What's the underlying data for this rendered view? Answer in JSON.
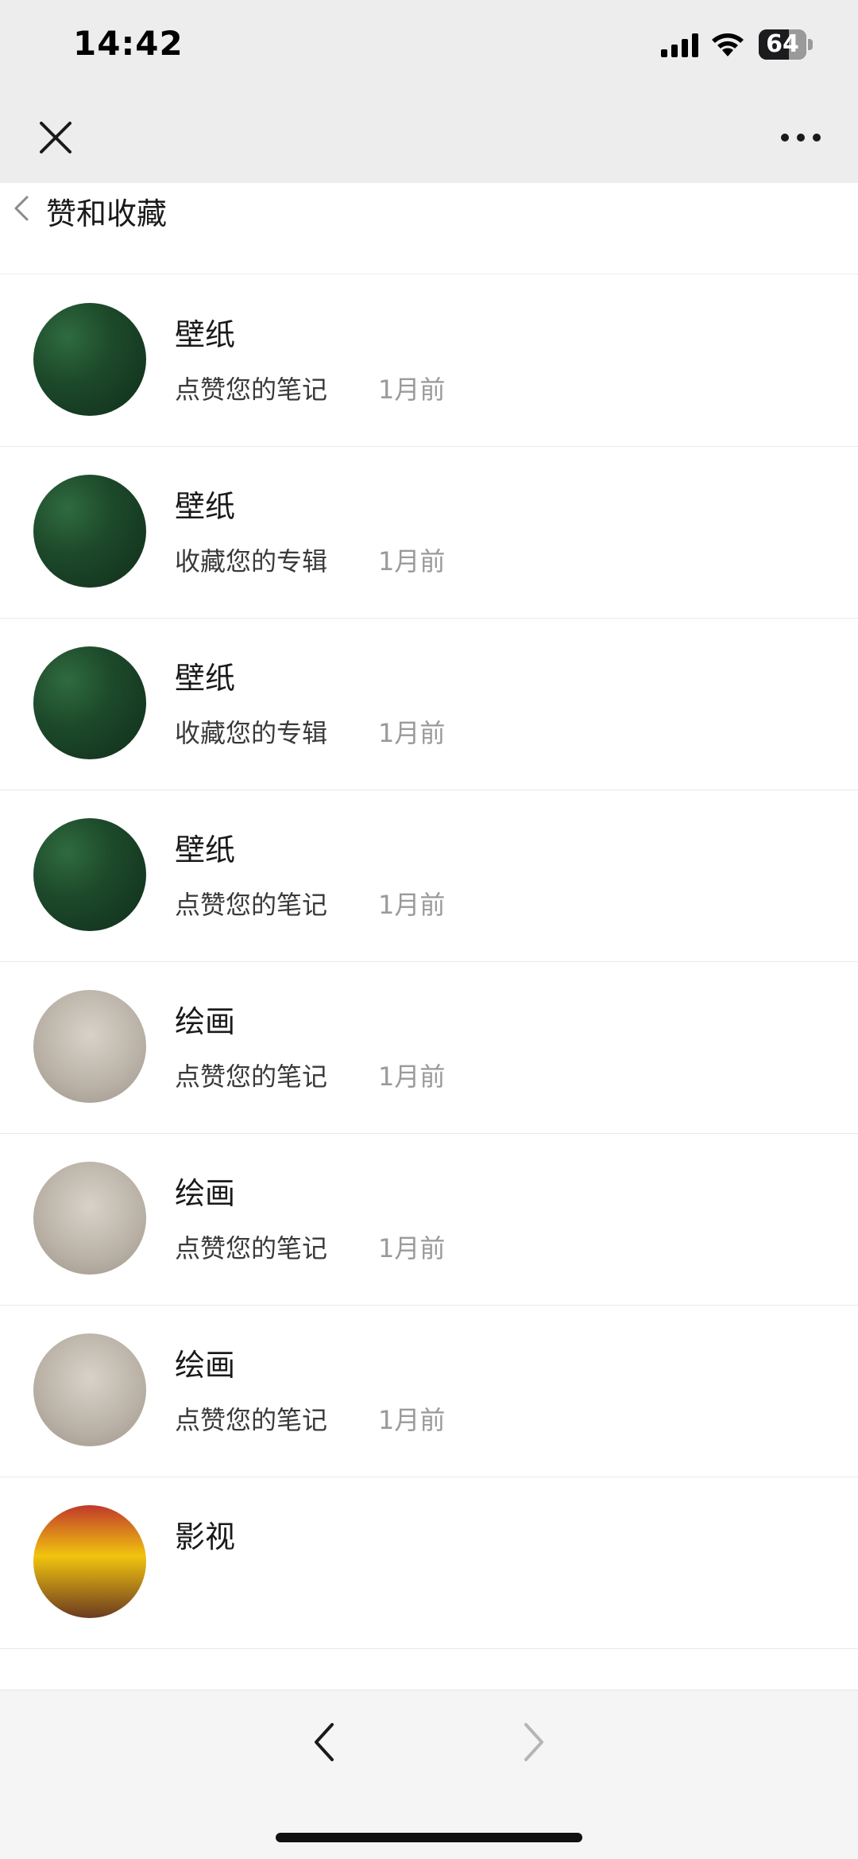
{
  "status_bar": {
    "time": "14:42",
    "battery_percent": 64,
    "battery_label": "64"
  },
  "nav": {
    "close_icon": "close-icon",
    "more_icon": "more-icon"
  },
  "header": {
    "title": "赞和收藏",
    "back_icon": "chevron-left-icon"
  },
  "notifications": [
    {
      "name": "壁纸",
      "action": "点赞您的笔记",
      "time": "1月前",
      "avatar": "forest"
    },
    {
      "name": "壁纸",
      "action": "收藏您的专辑",
      "time": "1月前",
      "avatar": "forest"
    },
    {
      "name": "壁纸",
      "action": "收藏您的专辑",
      "time": "1月前",
      "avatar": "forest"
    },
    {
      "name": "壁纸",
      "action": "点赞您的笔记",
      "time": "1月前",
      "avatar": "forest"
    },
    {
      "name": "绘画",
      "action": "点赞您的笔记",
      "time": "1月前",
      "avatar": "sketch"
    },
    {
      "name": "绘画",
      "action": "点赞您的笔记",
      "time": "1月前",
      "avatar": "sketch"
    },
    {
      "name": "绘画",
      "action": "点赞您的笔记",
      "time": "1月前",
      "avatar": "sketch"
    },
    {
      "name": "影视",
      "action": "",
      "time": "",
      "avatar": "film"
    }
  ],
  "toolbar": {
    "back_icon": "chevron-left-icon",
    "forward_icon": "chevron-right-icon"
  }
}
